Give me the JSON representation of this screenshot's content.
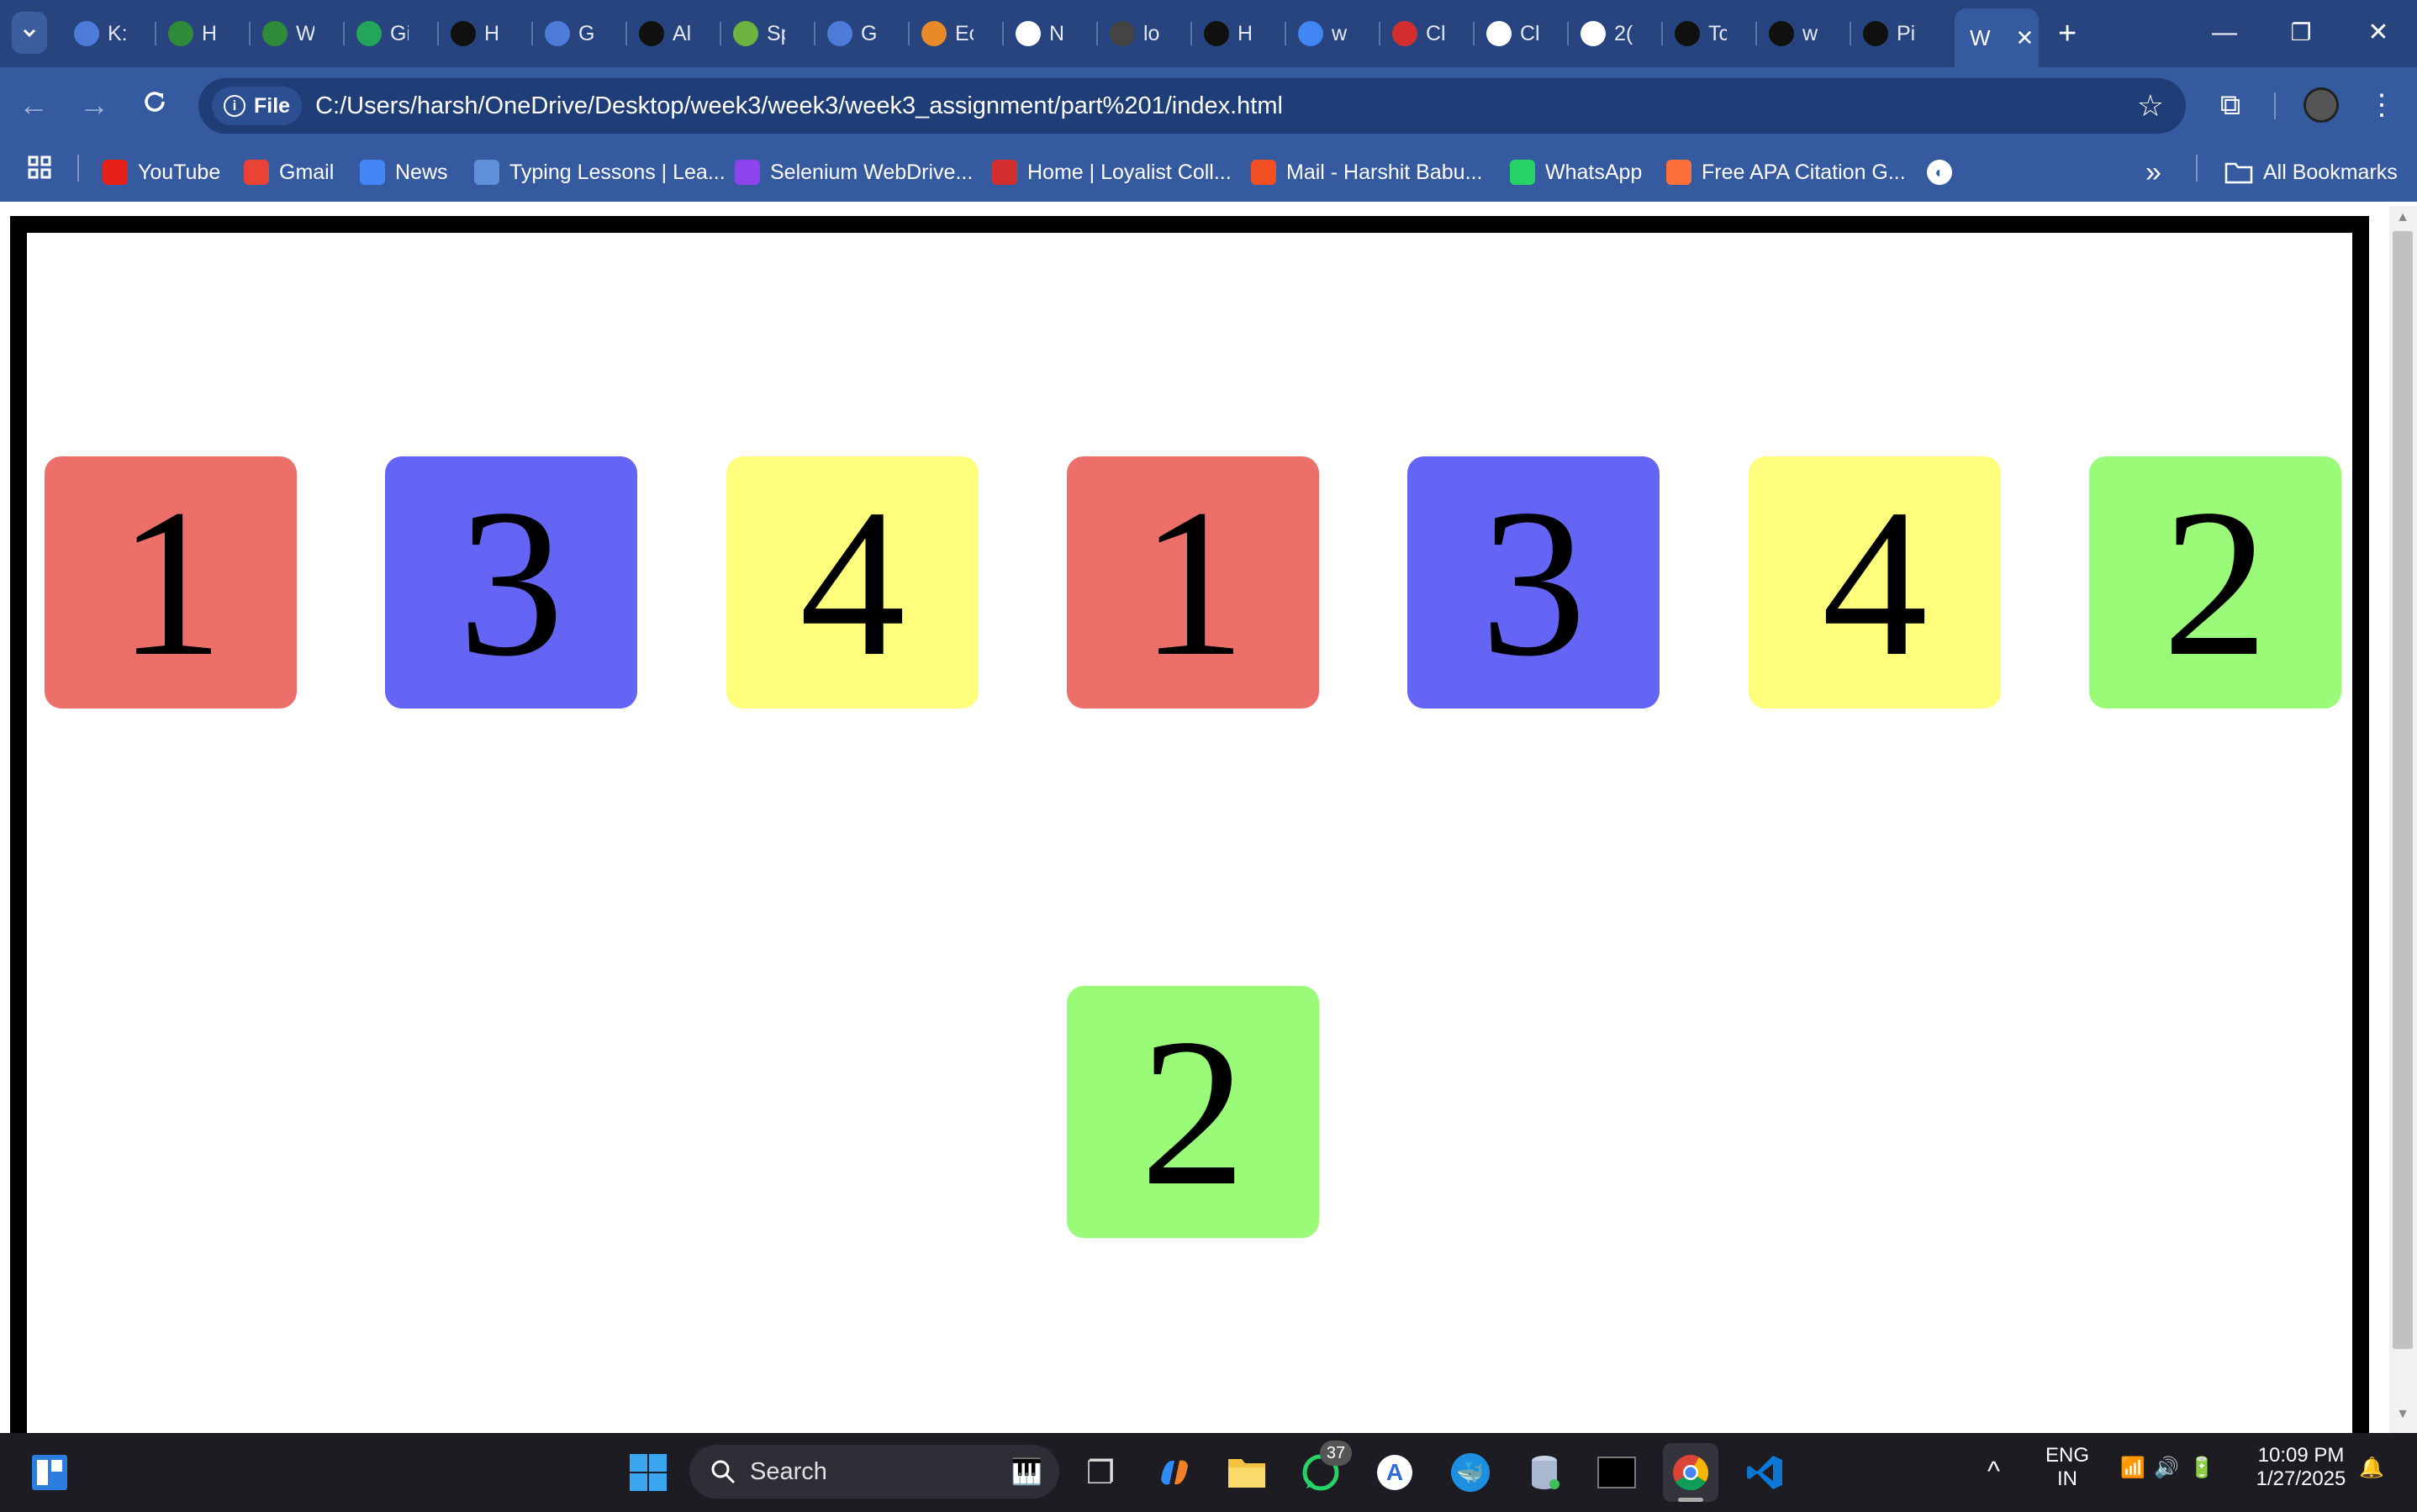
{
  "browser": {
    "tabs": [
      {
        "label": "K:",
        "icon": "tab-app-icon",
        "color": "#4c7bd9"
      },
      {
        "label": "H",
        "icon": "tab-w-icon",
        "color": "#2f8a3a"
      },
      {
        "label": "W",
        "icon": "tab-w-icon",
        "color": "#2f8a3a"
      },
      {
        "label": "Gi",
        "icon": "tab-sheets-icon",
        "color": "#23a55a"
      },
      {
        "label": "H",
        "icon": "tab-chatgpt-icon",
        "color": "#111111"
      },
      {
        "label": "G",
        "icon": "tab-gemini-icon",
        "color": "#4c7bd9"
      },
      {
        "label": "Al",
        "icon": "tab-chatgpt-icon",
        "color": "#111111"
      },
      {
        "label": "Sp",
        "icon": "tab-spring-icon",
        "color": "#6db33f"
      },
      {
        "label": "G",
        "icon": "tab-gemini-icon",
        "color": "#4c7bd9"
      },
      {
        "label": "Ec",
        "icon": "tab-ef-icon",
        "color": "#e8892a"
      },
      {
        "label": "N",
        "icon": "tab-chrome-icon",
        "color": "#ffffff"
      },
      {
        "label": "lo",
        "icon": "tab-react-icon",
        "color": "#444444"
      },
      {
        "label": "H",
        "icon": "tab-chatgpt-icon",
        "color": "#111111"
      },
      {
        "label": "w",
        "icon": "tab-docs-icon",
        "color": "#4285f4"
      },
      {
        "label": "Cl",
        "icon": "tab-app-icon",
        "color": "#d32f2f"
      },
      {
        "label": "Cl",
        "icon": "tab-app-icon",
        "color": "#ffffff"
      },
      {
        "label": "2(",
        "icon": "tab-app-icon",
        "color": "#ffffff"
      },
      {
        "label": "Tc",
        "icon": "tab-chatgpt-icon",
        "color": "#111111"
      },
      {
        "label": "w",
        "icon": "tab-github-icon",
        "color": "#111111"
      },
      {
        "label": "Pi",
        "icon": "tab-chatgpt-icon",
        "color": "#111111"
      }
    ],
    "active_tab": {
      "label": "W"
    },
    "url_chip": "File",
    "url": "C:/Users/harsh/OneDrive/Desktop/week3/week3/week3_assignment/part%201/index.html",
    "bookmarks": [
      {
        "label": "YouTube",
        "color": "#e62117"
      },
      {
        "label": "Gmail",
        "color": "#ea4335"
      },
      {
        "label": "News",
        "color": "#4285f4"
      },
      {
        "label": "Typing Lessons | Lea...",
        "color": "#5f8fd6"
      },
      {
        "label": "Selenium WebDrive...",
        "color": "#8e44ec"
      },
      {
        "label": "Home | Loyalist Coll...",
        "color": "#d32f2f"
      },
      {
        "label": "Mail - Harshit Babu...",
        "color": "#f25022"
      },
      {
        "label": "WhatsApp",
        "color": "#25d366"
      },
      {
        "label": "Free APA Citation G...",
        "color": "#ff6f3c"
      }
    ],
    "all_bookmarks": "All Bookmarks"
  },
  "page": {
    "cards": [
      {
        "number": "1",
        "color": "#ec7069"
      },
      {
        "number": "3",
        "color": "#6464f5"
      },
      {
        "number": "4",
        "color": "#fefe7c"
      },
      {
        "number": "1",
        "color": "#ec7069"
      },
      {
        "number": "3",
        "color": "#6464f5"
      },
      {
        "number": "4",
        "color": "#fefe7c"
      },
      {
        "number": "2",
        "color": "#99fb78"
      },
      {
        "number": "2",
        "color": "#99fb78"
      }
    ]
  },
  "taskbar": {
    "search_placeholder": "Search",
    "whatsapp_badge": "37",
    "lang_top": "ENG",
    "lang_bottom": "IN",
    "time": "10:09 PM",
    "date": "1/27/2025"
  }
}
